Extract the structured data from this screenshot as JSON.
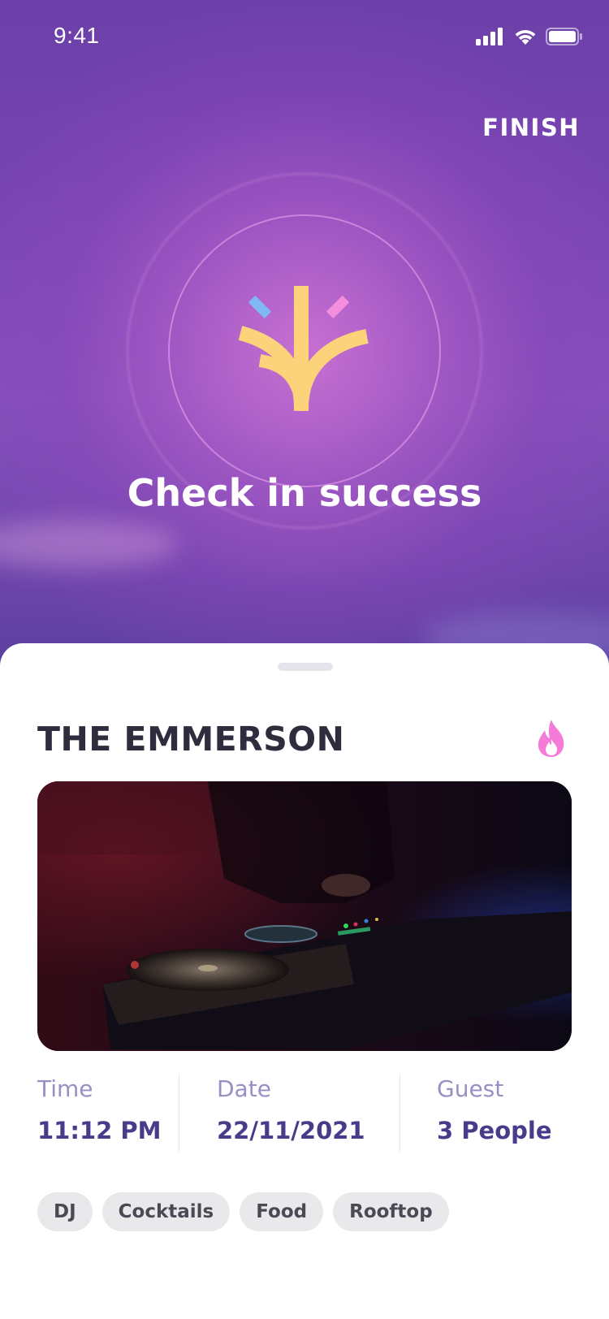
{
  "status_bar": {
    "time": "9:41"
  },
  "header": {
    "finish_label": "FINISH"
  },
  "success": {
    "title": "Check in success",
    "icon": "celebration-burst-icon"
  },
  "venue": {
    "name": "THE EMMERSON",
    "hot_icon": "fire-icon",
    "photo": "dj-turntable-photo"
  },
  "details": [
    {
      "label": "Time",
      "value": "11:12 PM"
    },
    {
      "label": "Date",
      "value": "22/11/2021"
    },
    {
      "label": "Guest",
      "value": "3 People"
    }
  ],
  "tags": [
    "DJ",
    "Cocktails",
    "Food",
    "Rooftop"
  ],
  "colors": {
    "accent_purple": "#7a46b4",
    "icon_yellow": "#fcd37a",
    "icon_blue": "#7fb8f4",
    "icon_pink": "#f58fdd",
    "fire_pink": "#f57bd9",
    "label_purple": "#9a8ec4",
    "value_purple": "#4a3a8a",
    "tag_bg": "#e9e9ec"
  }
}
